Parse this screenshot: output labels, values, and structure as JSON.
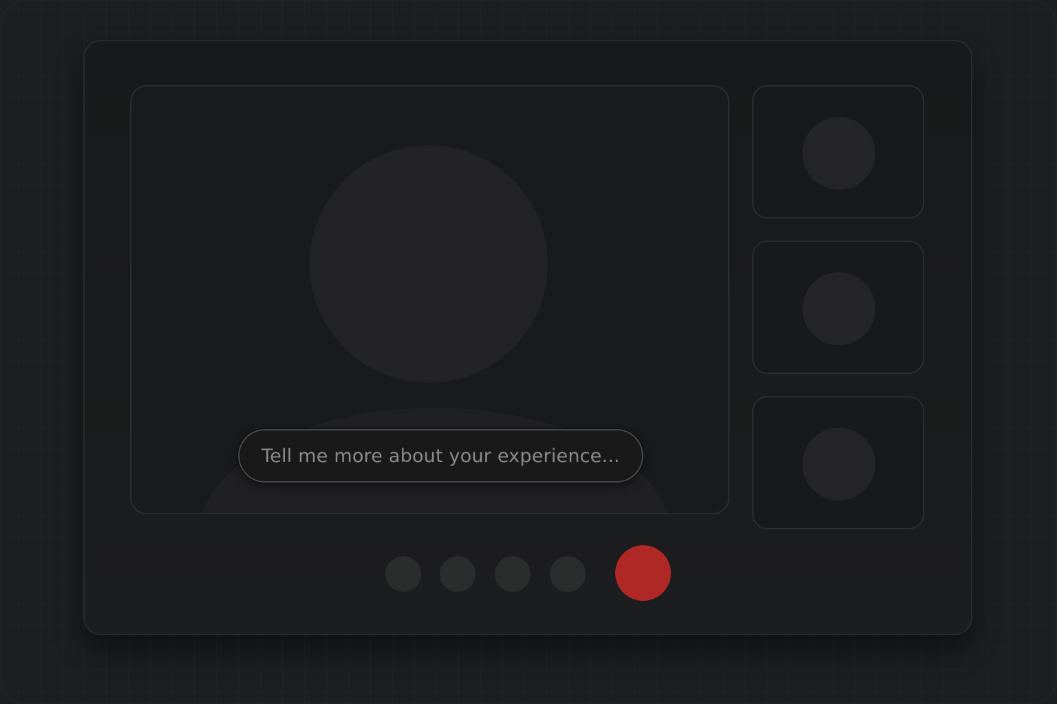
{
  "app": {
    "type": "video-call"
  },
  "main_video": {
    "participant": "main-speaker",
    "caption_text": "Tell me more about your experience..."
  },
  "thumbnails": [
    {
      "participant": "participant-1"
    },
    {
      "participant": "participant-2"
    },
    {
      "participant": "participant-3"
    }
  ],
  "controls": {
    "buttons": [
      {
        "name": "control-button-1"
      },
      {
        "name": "control-button-2"
      },
      {
        "name": "control-button-3"
      },
      {
        "name": "control-button-4"
      }
    ],
    "end_call": {
      "color": "#b02826"
    }
  },
  "colors": {
    "background": "#1d1e1f",
    "window": "#18191a",
    "placeholder": "#232325",
    "control": "#2b2d2d",
    "end_call": "#b02826",
    "caption_text": "#8a8b8c"
  }
}
